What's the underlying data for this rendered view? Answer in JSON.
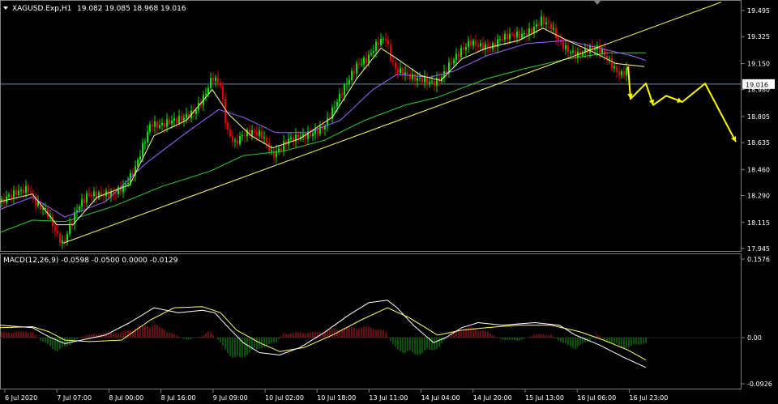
{
  "chart_data": [
    {
      "type": "candlestick",
      "header": {
        "symbol_label": "XAGUSD.Exp,H1",
        "ohlc": "19.082 19.085 18.968 19.016"
      },
      "y_ticks": [
        "19.495",
        "19.325",
        "19.150",
        "18.980",
        "18.805",
        "18.635",
        "18.460",
        "18.290",
        "18.115",
        "17.945"
      ],
      "ylim": [
        17.945,
        19.495
      ],
      "current_price": "19.016",
      "x_ticks": [
        "6 Jul 2020",
        "7 Jul 07:00",
        "8 Jul 00:00",
        "8 Jul 16:00",
        "9 Jul 09:00",
        "10 Jul 02:00",
        "10 Jul 18:00",
        "13 Jul 11:00",
        "14 Jul 04:00",
        "14 Jul 20:00",
        "15 Jul 13:00",
        "16 Jul 06:00",
        "16 Jul 23:00"
      ],
      "colors": {
        "bull": "#00e600",
        "bear": "#e60000",
        "trendline": "#ffff66",
        "ma_fast": "#ffff99",
        "ma_mid": "#9966ff",
        "ma_slow": "#33cc33",
        "forecast": "#ffff00",
        "price_line": "#6b8fb0"
      },
      "price_path": [
        [
          0,
          18.25
        ],
        [
          10,
          18.3
        ],
        [
          22,
          18.33
        ],
        [
          34,
          18.35
        ],
        [
          45,
          18.25
        ],
        [
          58,
          18.2
        ],
        [
          70,
          18.05
        ],
        [
          78,
          17.98
        ],
        [
          86,
          18.1
        ],
        [
          96,
          18.22
        ],
        [
          108,
          18.3
        ],
        [
          124,
          18.3
        ],
        [
          140,
          18.3
        ],
        [
          154,
          18.35
        ],
        [
          166,
          18.45
        ],
        [
          176,
          18.6
        ],
        [
          186,
          18.75
        ],
        [
          196,
          18.73
        ],
        [
          210,
          18.76
        ],
        [
          226,
          18.78
        ],
        [
          240,
          18.82
        ],
        [
          252,
          18.92
        ],
        [
          262,
          19.05
        ],
        [
          272,
          19.0
        ],
        [
          280,
          18.7
        ],
        [
          290,
          18.62
        ],
        [
          300,
          18.68
        ],
        [
          312,
          18.7
        ],
        [
          324,
          18.68
        ],
        [
          336,
          18.55
        ],
        [
          346,
          18.6
        ],
        [
          356,
          18.66
        ],
        [
          370,
          18.68
        ],
        [
          384,
          18.7
        ],
        [
          400,
          18.75
        ],
        [
          414,
          18.9
        ],
        [
          426,
          19.02
        ],
        [
          440,
          19.15
        ],
        [
          454,
          19.2
        ],
        [
          466,
          19.3
        ],
        [
          476,
          19.33
        ],
        [
          482,
          19.2
        ],
        [
          488,
          19.12
        ],
        [
          498,
          19.1
        ],
        [
          510,
          19.06
        ],
        [
          522,
          19.05
        ],
        [
          534,
          19.02
        ],
        [
          544,
          19.05
        ],
        [
          556,
          19.15
        ],
        [
          568,
          19.22
        ],
        [
          580,
          19.28
        ],
        [
          594,
          19.25
        ],
        [
          606,
          19.24
        ],
        [
          618,
          19.3
        ],
        [
          630,
          19.32
        ],
        [
          644,
          19.32
        ],
        [
          656,
          19.35
        ],
        [
          668,
          19.42
        ],
        [
          680,
          19.38
        ],
        [
          690,
          19.28
        ],
        [
          702,
          19.22
        ],
        [
          714,
          19.2
        ],
        [
          726,
          19.24
        ],
        [
          738,
          19.25
        ],
        [
          748,
          19.2
        ],
        [
          758,
          19.12
        ],
        [
          766,
          19.08
        ],
        [
          776,
          19.13
        ]
      ],
      "ma_fast_path": [
        [
          0,
          18.25
        ],
        [
          40,
          18.3
        ],
        [
          70,
          18.1
        ],
        [
          90,
          18.1
        ],
        [
          120,
          18.28
        ],
        [
          160,
          18.36
        ],
        [
          190,
          18.68
        ],
        [
          230,
          18.78
        ],
        [
          262,
          18.98
        ],
        [
          282,
          18.82
        ],
        [
          310,
          18.68
        ],
        [
          336,
          18.6
        ],
        [
          370,
          18.66
        ],
        [
          410,
          18.8
        ],
        [
          440,
          19.05
        ],
        [
          470,
          19.25
        ],
        [
          490,
          19.18
        ],
        [
          520,
          19.07
        ],
        [
          544,
          19.04
        ],
        [
          570,
          19.18
        ],
        [
          600,
          19.25
        ],
        [
          640,
          19.3
        ],
        [
          670,
          19.38
        ],
        [
          700,
          19.3
        ],
        [
          730,
          19.23
        ],
        [
          760,
          19.15
        ],
        [
          795,
          19.13
        ]
      ],
      "ma_mid_path": [
        [
          0,
          18.2
        ],
        [
          40,
          18.28
        ],
        [
          80,
          18.15
        ],
        [
          130,
          18.25
        ],
        [
          180,
          18.5
        ],
        [
          230,
          18.7
        ],
        [
          270,
          18.85
        ],
        [
          300,
          18.8
        ],
        [
          340,
          18.7
        ],
        [
          380,
          18.7
        ],
        [
          420,
          18.78
        ],
        [
          460,
          18.98
        ],
        [
          490,
          19.08
        ],
        [
          530,
          19.06
        ],
        [
          560,
          19.1
        ],
        [
          600,
          19.2
        ],
        [
          650,
          19.28
        ],
        [
          700,
          19.3
        ],
        [
          740,
          19.25
        ],
        [
          780,
          19.2
        ],
        [
          797,
          19.17
        ]
      ],
      "ma_slow_path": [
        [
          0,
          18.05
        ],
        [
          40,
          18.13
        ],
        [
          80,
          18.12
        ],
        [
          140,
          18.22
        ],
        [
          200,
          18.35
        ],
        [
          260,
          18.45
        ],
        [
          300,
          18.55
        ],
        [
          350,
          18.58
        ],
        [
          400,
          18.65
        ],
        [
          450,
          18.78
        ],
        [
          500,
          18.88
        ],
        [
          540,
          18.93
        ],
        [
          600,
          19.05
        ],
        [
          650,
          19.12
        ],
        [
          700,
          19.18
        ],
        [
          750,
          19.22
        ],
        [
          797,
          19.22
        ]
      ],
      "trendline": [
        [
          78,
          17.98
        ],
        [
          890,
          19.55
        ]
      ],
      "forecast_path": [
        [
          775,
          19.13
        ],
        [
          778,
          18.92
        ],
        [
          797,
          19.02
        ],
        [
          806,
          18.88
        ],
        [
          822,
          18.94
        ],
        [
          832,
          18.92
        ],
        [
          842,
          18.9
        ],
        [
          870,
          19.02
        ],
        [
          908,
          18.64
        ]
      ]
    },
    {
      "type": "macd",
      "label": "MACD(12,26,9) -0.0598 -0.0500 0.0000 -0.0129",
      "y_ticks": [
        "0.1576",
        "0.00",
        "-0.0926"
      ],
      "ylim": [
        -0.0926,
        0.1576
      ],
      "zero": 0.0,
      "colors": {
        "pos": "#cc2020",
        "neg": "#18a018",
        "macd": "#ffffff",
        "signal": "#ffff66"
      },
      "histogram": [
        [
          0,
          0.01
        ],
        [
          40,
          0.012
        ],
        [
          50,
          -0.005
        ],
        [
          70,
          -0.025
        ],
        [
          80,
          -0.02
        ],
        [
          100,
          0.002
        ],
        [
          120,
          0.008
        ],
        [
          150,
          0.01
        ],
        [
          170,
          0.02
        ],
        [
          190,
          0.025
        ],
        [
          210,
          0.01
        ],
        [
          230,
          -0.005
        ],
        [
          250,
          0.004
        ],
        [
          258,
          0.012
        ],
        [
          265,
          0.002
        ],
        [
          280,
          -0.025
        ],
        [
          290,
          -0.045
        ],
        [
          300,
          -0.035
        ],
        [
          320,
          -0.02
        ],
        [
          340,
          -0.01
        ],
        [
          350,
          0.008
        ],
        [
          370,
          0.01
        ],
        [
          390,
          0.01
        ],
        [
          420,
          0.018
        ],
        [
          440,
          0.02
        ],
        [
          460,
          0.02
        ],
        [
          475,
          0.012
        ],
        [
          485,
          -0.015
        ],
        [
          500,
          -0.03
        ],
        [
          520,
          -0.03
        ],
        [
          540,
          -0.02
        ],
        [
          560,
          0.012
        ],
        [
          580,
          0.02
        ],
        [
          600,
          0.012
        ],
        [
          620,
          -0.004
        ],
        [
          640,
          -0.006
        ],
        [
          660,
          0.006
        ],
        [
          680,
          0.006
        ],
        [
          695,
          -0.012
        ],
        [
          710,
          -0.02
        ],
        [
          725,
          -0.008
        ],
        [
          738,
          0.007
        ],
        [
          750,
          -0.008
        ],
        [
          770,
          -0.02
        ],
        [
          797,
          -0.01
        ]
      ],
      "macd_line": [
        [
          0,
          0.025
        ],
        [
          40,
          0.02
        ],
        [
          60,
          0.002
        ],
        [
          80,
          -0.012
        ],
        [
          100,
          -0.005
        ],
        [
          130,
          0.005
        ],
        [
          160,
          0.03
        ],
        [
          190,
          0.06
        ],
        [
          220,
          0.05
        ],
        [
          250,
          0.055
        ],
        [
          265,
          0.05
        ],
        [
          282,
          0.02
        ],
        [
          300,
          -0.01
        ],
        [
          320,
          -0.03
        ],
        [
          345,
          -0.035
        ],
        [
          370,
          -0.02
        ],
        [
          400,
          0.01
        ],
        [
          430,
          0.045
        ],
        [
          455,
          0.07
        ],
        [
          478,
          0.075
        ],
        [
          490,
          0.06
        ],
        [
          510,
          0.025
        ],
        [
          535,
          -0.01
        ],
        [
          550,
          0.0
        ],
        [
          570,
          0.02
        ],
        [
          590,
          0.03
        ],
        [
          620,
          0.025
        ],
        [
          660,
          0.03
        ],
        [
          690,
          0.025
        ],
        [
          710,
          0.005
        ],
        [
          740,
          -0.015
        ],
        [
          770,
          -0.04
        ],
        [
          797,
          -0.06
        ]
      ],
      "signal_line": [
        [
          0,
          0.02
        ],
        [
          40,
          0.022
        ],
        [
          60,
          0.012
        ],
        [
          80,
          -0.005
        ],
        [
          110,
          -0.008
        ],
        [
          150,
          -0.005
        ],
        [
          185,
          0.035
        ],
        [
          215,
          0.06
        ],
        [
          250,
          0.062
        ],
        [
          272,
          0.05
        ],
        [
          292,
          0.015
        ],
        [
          320,
          -0.01
        ],
        [
          345,
          -0.028
        ],
        [
          375,
          -0.02
        ],
        [
          410,
          0.005
        ],
        [
          445,
          0.035
        ],
        [
          478,
          0.06
        ],
        [
          505,
          0.04
        ],
        [
          540,
          0.005
        ],
        [
          570,
          0.015
        ],
        [
          600,
          0.02
        ],
        [
          640,
          0.025
        ],
        [
          680,
          0.025
        ],
        [
          715,
          0.012
        ],
        [
          745,
          -0.005
        ],
        [
          775,
          -0.025
        ],
        [
          797,
          -0.045
        ]
      ]
    }
  ]
}
